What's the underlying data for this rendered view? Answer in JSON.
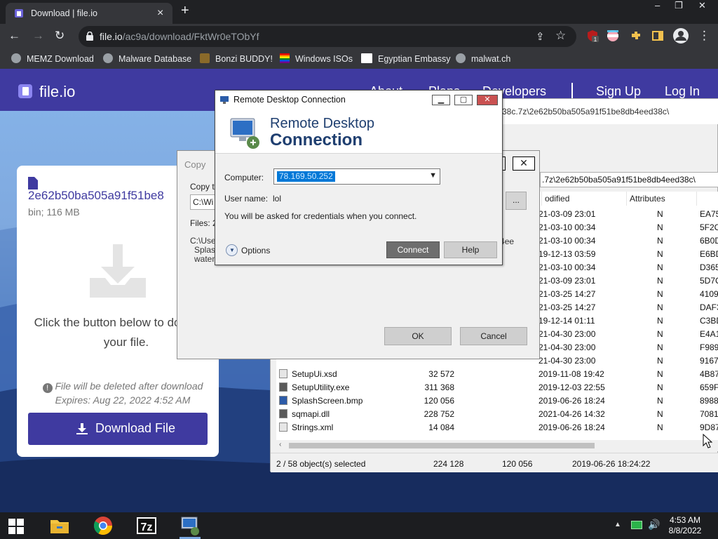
{
  "browser": {
    "tab_title": "Download | file.io",
    "new_tab_label": "+",
    "url_domain": "file.io",
    "url_path": "/ac9a/download/FktWr0eTObYf",
    "bookmarks": [
      {
        "label": "MEMZ Download",
        "color": "#9aa0a6"
      },
      {
        "label": "Malware Database",
        "color": "#9aa0a6"
      },
      {
        "label": "Bonzi BUDDY!",
        "color": "#7a5a2a"
      },
      {
        "label": "Windows ISOs",
        "color": "#e44d26"
      },
      {
        "label": "Egyptian Embassy",
        "color": "#ffffff"
      },
      {
        "label": "malwat.ch",
        "color": "#9aa0a6"
      }
    ],
    "ext_badge": "1"
  },
  "fileio": {
    "brand": "file.io",
    "nav": [
      "About",
      "Plans",
      "Developers"
    ],
    "sign_up": "Sign Up",
    "log_in": "Log In",
    "file_name": "2e62b50ba505a91f51be8",
    "file_meta": "bin; 116 MB",
    "click_text": "Click the button below to download your file.",
    "warning": "File will be deleted after download",
    "expires": "Expires: Aug 22, 2022 4:52 AM",
    "download_button": "Download File",
    "brand_color": "#3f3aa0"
  },
  "sevenzip": {
    "path_top": "38c.7z\\2e62b50ba505a91f51be8db4eed38c\\",
    "path_field": ".7z\\2e62b50ba505a91f51be8db4eed38c\\",
    "columns": [
      "odified",
      "Attributes"
    ],
    "rows": [
      {
        "name": "",
        "size": "",
        "modified": "21-03-09 23:01",
        "attr": "N",
        "crc": "EA75"
      },
      {
        "name": "",
        "size": "",
        "modified": "21-03-10 00:34",
        "attr": "N",
        "crc": "5F2C"
      },
      {
        "name": "",
        "size": "",
        "modified": "21-03-10 00:34",
        "attr": "N",
        "crc": "6B0D"
      },
      {
        "name": "",
        "size": "",
        "modified": "19-12-13 03:59",
        "attr": "N",
        "crc": "E6BD"
      },
      {
        "name": "",
        "size": "",
        "modified": "21-03-10 00:34",
        "attr": "N",
        "crc": "D365"
      },
      {
        "name": "",
        "size": "",
        "modified": "21-03-09 23:01",
        "attr": "N",
        "crc": "5D7C"
      },
      {
        "name": "",
        "size": "",
        "modified": "21-03-25 14:27",
        "attr": "N",
        "crc": "4109"
      },
      {
        "name": "",
        "size": "",
        "modified": "21-03-25 14:27",
        "attr": "N",
        "crc": "DAF3"
      },
      {
        "name": "",
        "size": "",
        "modified": "19-12-14 01:11",
        "attr": "N",
        "crc": "C3BD"
      },
      {
        "name": "",
        "size": "",
        "modified": "21-04-30 23:00",
        "attr": "N",
        "crc": "E4A1"
      },
      {
        "name": "",
        "size": "",
        "modified": "21-04-30 23:00",
        "attr": "N",
        "crc": "F989"
      },
      {
        "name": "",
        "size": "",
        "modified": "21-04-30 23:00",
        "attr": "N",
        "crc": "9167"
      },
      {
        "name": "SetupUi.xsd",
        "size": "32 572",
        "modified": "2019-11-08 19:42",
        "attr": "N",
        "crc": "4B87"
      },
      {
        "name": "SetupUtility.exe",
        "size": "311 368",
        "modified": "2019-12-03 22:55",
        "attr": "N",
        "crc": "659F"
      },
      {
        "name": "SplashScreen.bmp",
        "size": "120 056",
        "modified": "2019-06-26 18:24",
        "attr": "N",
        "crc": "8988"
      },
      {
        "name": "sqmapi.dll",
        "size": "228 752",
        "modified": "2021-04-26 14:32",
        "attr": "N",
        "crc": "7081"
      },
      {
        "name": "Strings.xml",
        "size": "14 084",
        "modified": "2019-06-26 18:24",
        "attr": "N",
        "crc": "9D87"
      }
    ],
    "status": {
      "selected": "2 / 58 object(s) selected",
      "size": "224 128",
      "packed": "120 056",
      "date": "2019-06-26 18:24:22"
    }
  },
  "copy_dialog": {
    "title": "Copy",
    "copy_to_label": "Copy to",
    "copy_to_value": "C:\\Wi",
    "browse": "...",
    "files_label": "Files: 2",
    "src_lines": [
      "C:\\Use",
      "Splas",
      "watem"
    ],
    "src_right": "8db4ee",
    "ok": "OK",
    "cancel": "Cancel"
  },
  "rdc": {
    "title": "Remote Desktop Connection",
    "banner_line1": "Remote Desktop",
    "banner_line2": "Connection",
    "computer_label": "Computer:",
    "computer_value": "78.169.50.252",
    "user_label": "User name:",
    "user_value": "lol",
    "cred_msg": "You will be asked for credentials when you connect.",
    "options": "Options",
    "connect": "Connect",
    "help": "Help"
  },
  "taskbar": {
    "time": "4:53 AM",
    "date": "8/8/2022"
  }
}
